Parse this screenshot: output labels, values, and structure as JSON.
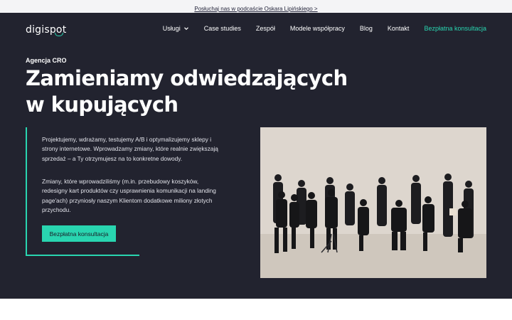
{
  "topbar": {
    "podcast_link": "Posłuchaj nas w podcaście Oskara Lipińskiego >"
  },
  "header": {
    "logo": "digispot",
    "nav": [
      {
        "label": "Usługi",
        "has_dropdown": true
      },
      {
        "label": "Case studies"
      },
      {
        "label": "Zespół"
      },
      {
        "label": "Modele współpracy"
      },
      {
        "label": "Blog"
      },
      {
        "label": "Kontakt"
      },
      {
        "label": "Bezpłatna konsultacja",
        "accent": true
      }
    ]
  },
  "hero": {
    "eyebrow": "Agencja CRO",
    "headline_line1": "Zamieniamy odwiedzających",
    "headline_line2": "w kupujących",
    "paragraph1": "Projektujemy, wdrażamy, testujemy A/B i optymalizujemy sklepy i strony internetowe. Wprowadzamy zmiany, które realnie zwiększają sprzedaż – a Ty otrzymujesz na to konkretne dowody.",
    "paragraph2": "Zmiany, które wprowadziliśmy (m.in. przebudowy koszyków, redesigny kart produktów czy usprawnienia komunikacji na landing page'ach) przyniosły naszym Klientom dodatkowe miliony złotych przychodu.",
    "cta_label": "Bezpłatna konsultacja",
    "photo_icon": "team-photo"
  },
  "colors": {
    "background_dark": "#22232f",
    "accent": "#29d5b0",
    "topbar_bg": "#f4f4f6"
  }
}
